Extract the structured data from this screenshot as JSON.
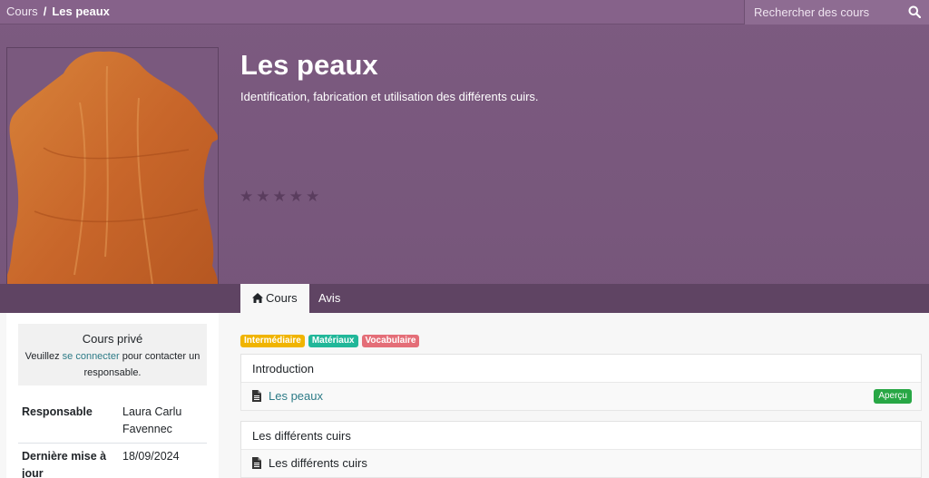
{
  "breadcrumb": {
    "root": "Cours",
    "separator": "/",
    "current": "Les peaux"
  },
  "search": {
    "placeholder": "Rechercher des cours"
  },
  "course": {
    "title": "Les peaux",
    "subtitle": "Identification, fabrication et utilisation des différents cuirs.",
    "rating_stars": 5,
    "rating_filled": 0
  },
  "tabs": [
    {
      "label": "Cours",
      "icon": "home-icon",
      "active": true
    },
    {
      "label": "Avis",
      "active": false
    }
  ],
  "sidebar": {
    "private_title": "Cours privé",
    "private_text_before": "Veuillez ",
    "private_link": "se connecter",
    "private_text_after": " pour contacter un responsable.",
    "meta": [
      {
        "label": "Responsable",
        "value": "Laura Carlu Favennec"
      },
      {
        "label": "Dernière mise à jour",
        "value": "18/09/2024"
      }
    ]
  },
  "tags": [
    {
      "label": "Intermédiaire",
      "color": "#f0b400"
    },
    {
      "label": "Matériaux",
      "color": "#21b799"
    },
    {
      "label": "Vocabulaire",
      "color": "#e46e78"
    }
  ],
  "sections": [
    {
      "title": "Introduction",
      "lesson": {
        "label": "Les peaux",
        "link": true,
        "badge": "Aperçu"
      }
    },
    {
      "title": "Les différents cuirs",
      "lesson": {
        "label": "Les différents cuirs",
        "link": false
      }
    }
  ],
  "colors": {
    "hero": "#7c5a80",
    "tabbar": "#5f4463",
    "link": "#2d7b87",
    "badge_green": "#28a745"
  }
}
